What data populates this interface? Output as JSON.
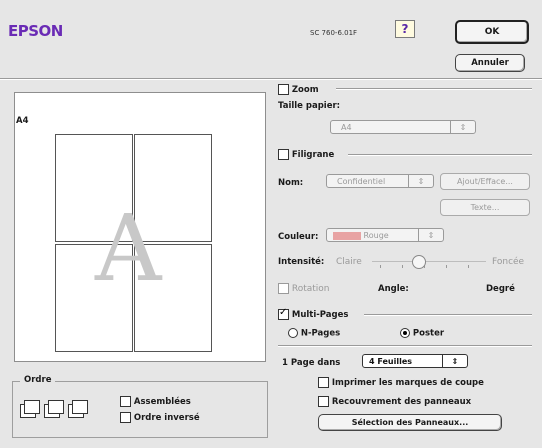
{
  "header": {
    "brand": "EPSON",
    "model": "SC 760-6.01F",
    "help_icon_text": "?",
    "ok_label": "OK",
    "cancel_label": "Annuler"
  },
  "preview": {
    "paper_label": "A4",
    "watermark_glyph": "A"
  },
  "zoom": {
    "title": "Zoom",
    "checked": false,
    "paper_size_label": "Taille papier:",
    "paper_size_value": "A4"
  },
  "watermark": {
    "title": "Filigrane",
    "checked": false,
    "name_label": "Nom:",
    "name_value": "Confidentiel",
    "add_remove_label": "Ajout/Efface...",
    "text_button_label": "Texte...",
    "color_label": "Couleur:",
    "color_value": "Rouge",
    "swatch_color": "#e8a3a3",
    "intensity_label": "Intensité:",
    "intensity_low_label": "Claire",
    "intensity_high_label": "Foncée",
    "intensity_level": 0.4,
    "rotation_label": "Rotation",
    "rotation_checked": false,
    "angle_label": "Angle:",
    "degree_label": "Degré"
  },
  "multipage": {
    "title": "Multi-Pages",
    "checked": true,
    "npages_label": "N-Pages",
    "poster_label": "Poster",
    "selected_mode": "Poster",
    "page_in_label": "1 Page dans",
    "page_in_value": "4 Feuilles",
    "crop_marks_label": "Imprimer les marques de coupe",
    "crop_marks_checked": false,
    "overlap_label": "Recouvrement des panneaux",
    "overlap_checked": false,
    "panel_selection_label": "Sélection des Panneaux..."
  },
  "order": {
    "title": "Ordre",
    "collate_label": "Assemblées",
    "collate_checked": false,
    "reverse_label": "Ordre inversé",
    "reverse_checked": false
  }
}
